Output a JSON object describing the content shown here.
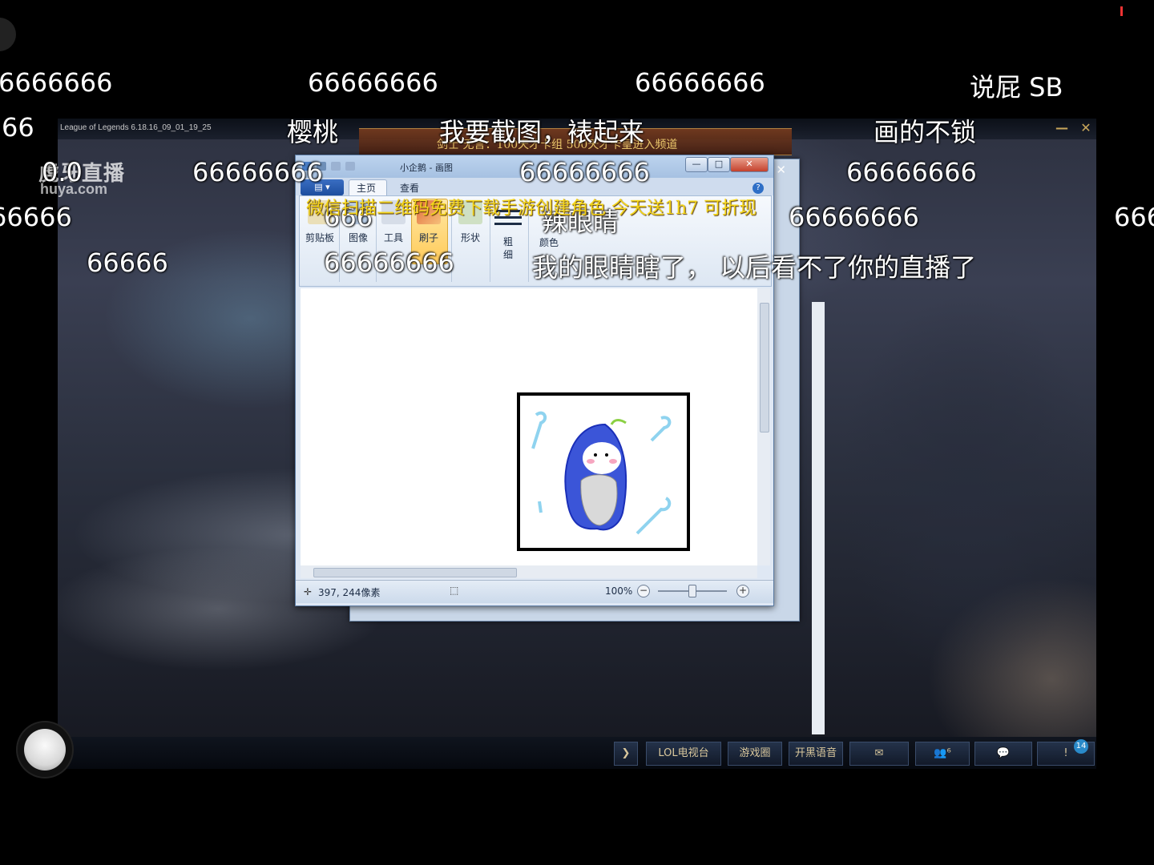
{
  "client": {
    "title": "League of Legends 6.18.16_09_01_19_25",
    "minimize": "—",
    "close": "✕",
    "banner": "剑士  无言：100天才卡组   500天才卡皇进入频道"
  },
  "watermark": {
    "logo": "虎牙直播",
    "url": "huya.com"
  },
  "paint": {
    "title": "小企鹅 - 画图",
    "tabs": [
      "主页",
      "查看"
    ],
    "file_label": "▤ ▾",
    "groups": [
      "剪贴板",
      "图像",
      "工具",
      "刷子",
      "形状",
      "粗\n细",
      "颜色"
    ],
    "status_coord": "397, 244像素",
    "zoom": "100%",
    "title_buttons": {
      "min": "—",
      "max": "□",
      "close": "✕"
    }
  },
  "bottom_bar": {
    "buttons": [
      "❯",
      "LOL电视台",
      "游戏圈",
      "开黑语音",
      "✉",
      "👥⁶",
      "💬",
      "!"
    ],
    "badge": "14"
  },
  "danmaku": [
    {
      "text": "6666666",
      "style": "white"
    },
    {
      "text": "66666666",
      "style": "white"
    },
    {
      "text": "66666666",
      "style": "white"
    },
    {
      "text": "说屁 SB",
      "style": "white"
    },
    {
      "text": "66",
      "style": "white"
    },
    {
      "text": "樱桃",
      "style": "white"
    },
    {
      "text": "我要截图，裱起来",
      "style": "white"
    },
    {
      "text": "画的不锁",
      "style": "white"
    },
    {
      "text": "0.0",
      "style": "white"
    },
    {
      "text": "66666666",
      "style": "white"
    },
    {
      "text": "66666666",
      "style": "white"
    },
    {
      "text": "66666666",
      "style": "white"
    },
    {
      "text": "66666",
      "style": "white"
    },
    {
      "text": "666",
      "style": "white"
    },
    {
      "text": "辣眼睛",
      "style": "white"
    },
    {
      "text": "66666666",
      "style": "white"
    },
    {
      "text": "666",
      "style": "white"
    },
    {
      "text": "66666",
      "style": "white"
    },
    {
      "text": "66666666",
      "style": "white"
    },
    {
      "text": "我的眼睛瞎了， 以后看不了你的直播了",
      "style": "white"
    },
    {
      "text": "微信扫描二维码免费下载手游创建角色  今天送1h7  可折现",
      "style": "yellow"
    }
  ]
}
